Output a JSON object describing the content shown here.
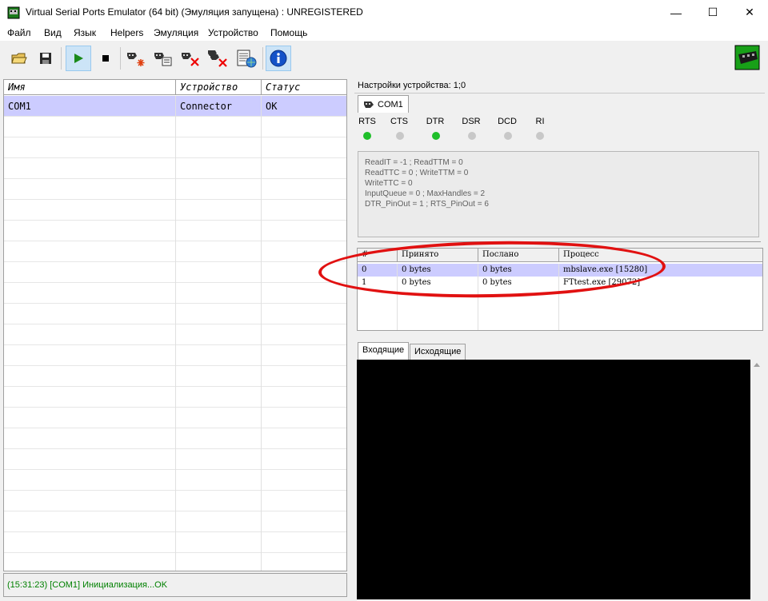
{
  "window": {
    "title": "Virtual Serial Ports Emulator (64 bit) (Эмуляция запущена) : UNREGISTERED",
    "min_glyph": "—",
    "max_glyph": "☐",
    "close_glyph": "✕"
  },
  "menu": [
    "Файл",
    "Вид",
    "Язык",
    "Helpers",
    "Эмуляция",
    "Устройство",
    "Помощь"
  ],
  "toolbar": {
    "icons": [
      "open-folder-icon",
      "save-disk-icon",
      "play-icon",
      "stop-icon",
      "add-device-icon",
      "edit-device-icon",
      "remove-device-icon",
      "remove-all-devices-icon",
      "device-list-icon",
      "info-icon"
    ],
    "active": "play-icon"
  },
  "device_list": {
    "columns": [
      "Имя",
      "Устройство",
      "Статус"
    ],
    "rows": [
      {
        "name": "COM1",
        "device": "Connector",
        "status": "OK"
      }
    ]
  },
  "status_message": "(15:31:23) [COM1] Инициализация...OK",
  "device_settings": {
    "caption": "Настройки устройства: 1;0",
    "tab": "COM1",
    "signals": [
      {
        "name": "RTS",
        "state": "on"
      },
      {
        "name": "CTS",
        "state": "off"
      },
      {
        "name": "DTR",
        "state": "on"
      },
      {
        "name": "DSR",
        "state": "off"
      },
      {
        "name": "DCD",
        "state": "off"
      },
      {
        "name": "RI",
        "state": "off"
      }
    ],
    "colors": {
      "on": "#1fbf2a",
      "off": "#c8c8c8"
    },
    "info_lines": [
      "ReadIT = -1 ; ReadTTM = 0",
      "ReadTTC = 0 ; WriteTTM = 0",
      "WriteTTC = 0",
      "InputQueue = 0 ; MaxHandles = 2",
      "DTR_PinOut = 1 ; RTS_PinOut = 6"
    ]
  },
  "process_table": {
    "columns": [
      "#",
      "Принято",
      "Послано",
      "Процесс"
    ],
    "rows": [
      {
        "index": "0",
        "received": "0 bytes",
        "sent": "0 bytes",
        "process": "mbslave.exe [15280]"
      },
      {
        "index": "1",
        "received": "0 bytes",
        "sent": "0 bytes",
        "process": "FTtest.exe [29072]"
      }
    ]
  },
  "io_tabs": [
    "Входящие",
    "Исходящие"
  ],
  "annotation_color": "#e11111"
}
